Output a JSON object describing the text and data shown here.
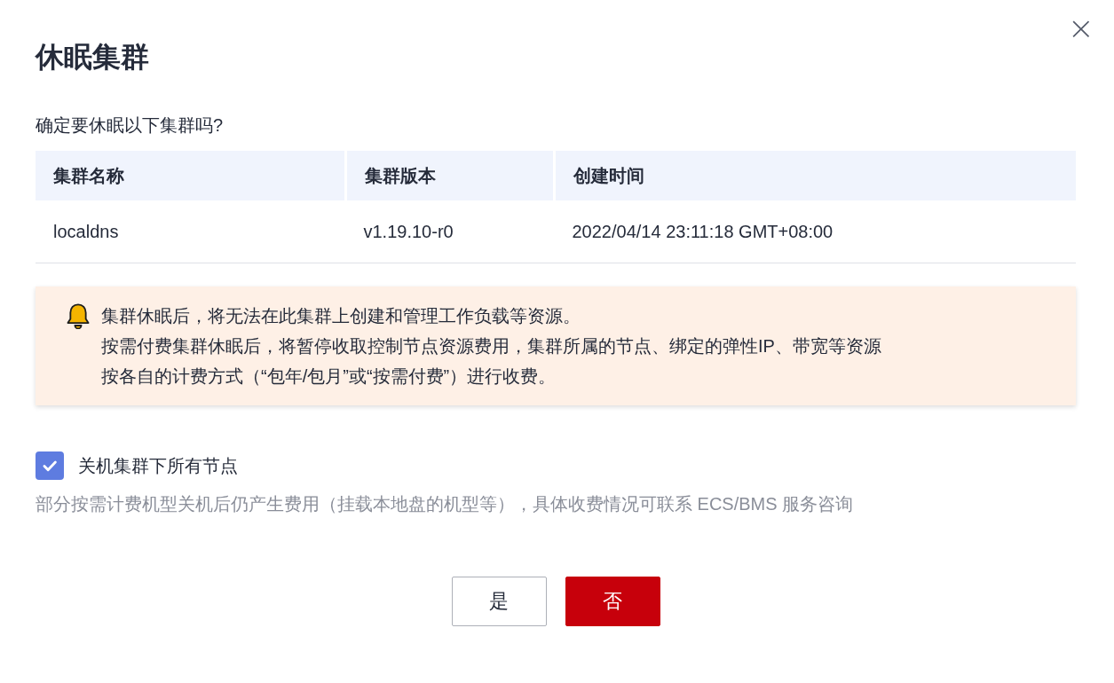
{
  "dialog": {
    "title": "休眠集群",
    "close_icon": "×"
  },
  "prompt": "确定要休眠以下集群吗?",
  "table": {
    "columns": [
      "集群名称",
      "集群版本",
      "创建时间"
    ],
    "rows": [
      [
        "localdns",
        "v1.19.10-r0",
        "2022/04/14 23:11:18 GMT+08:00"
      ]
    ]
  },
  "warning": {
    "lines": [
      "集群休眠后，将无法在此集群上创建和管理工作负载等资源。",
      "按需付费集群休眠后，将暂停收取控制节点资源费用，集群所属的节点、绑定的弹性IP、带宽等资源",
      "按各自的计费方式（“包年/包月”或“按需付费”）进行收费。"
    ]
  },
  "checkbox": {
    "label": "关机集群下所有节点",
    "checked": true
  },
  "hint": "部分按需计费机型关机后仍产生费用（挂载本地盘的机型等），具体收费情况可联系 ECS/BMS 服务咨询",
  "buttons": [
    {
      "label": "是",
      "kind": "secondary"
    },
    {
      "label": "否",
      "kind": "primary"
    }
  ]
}
